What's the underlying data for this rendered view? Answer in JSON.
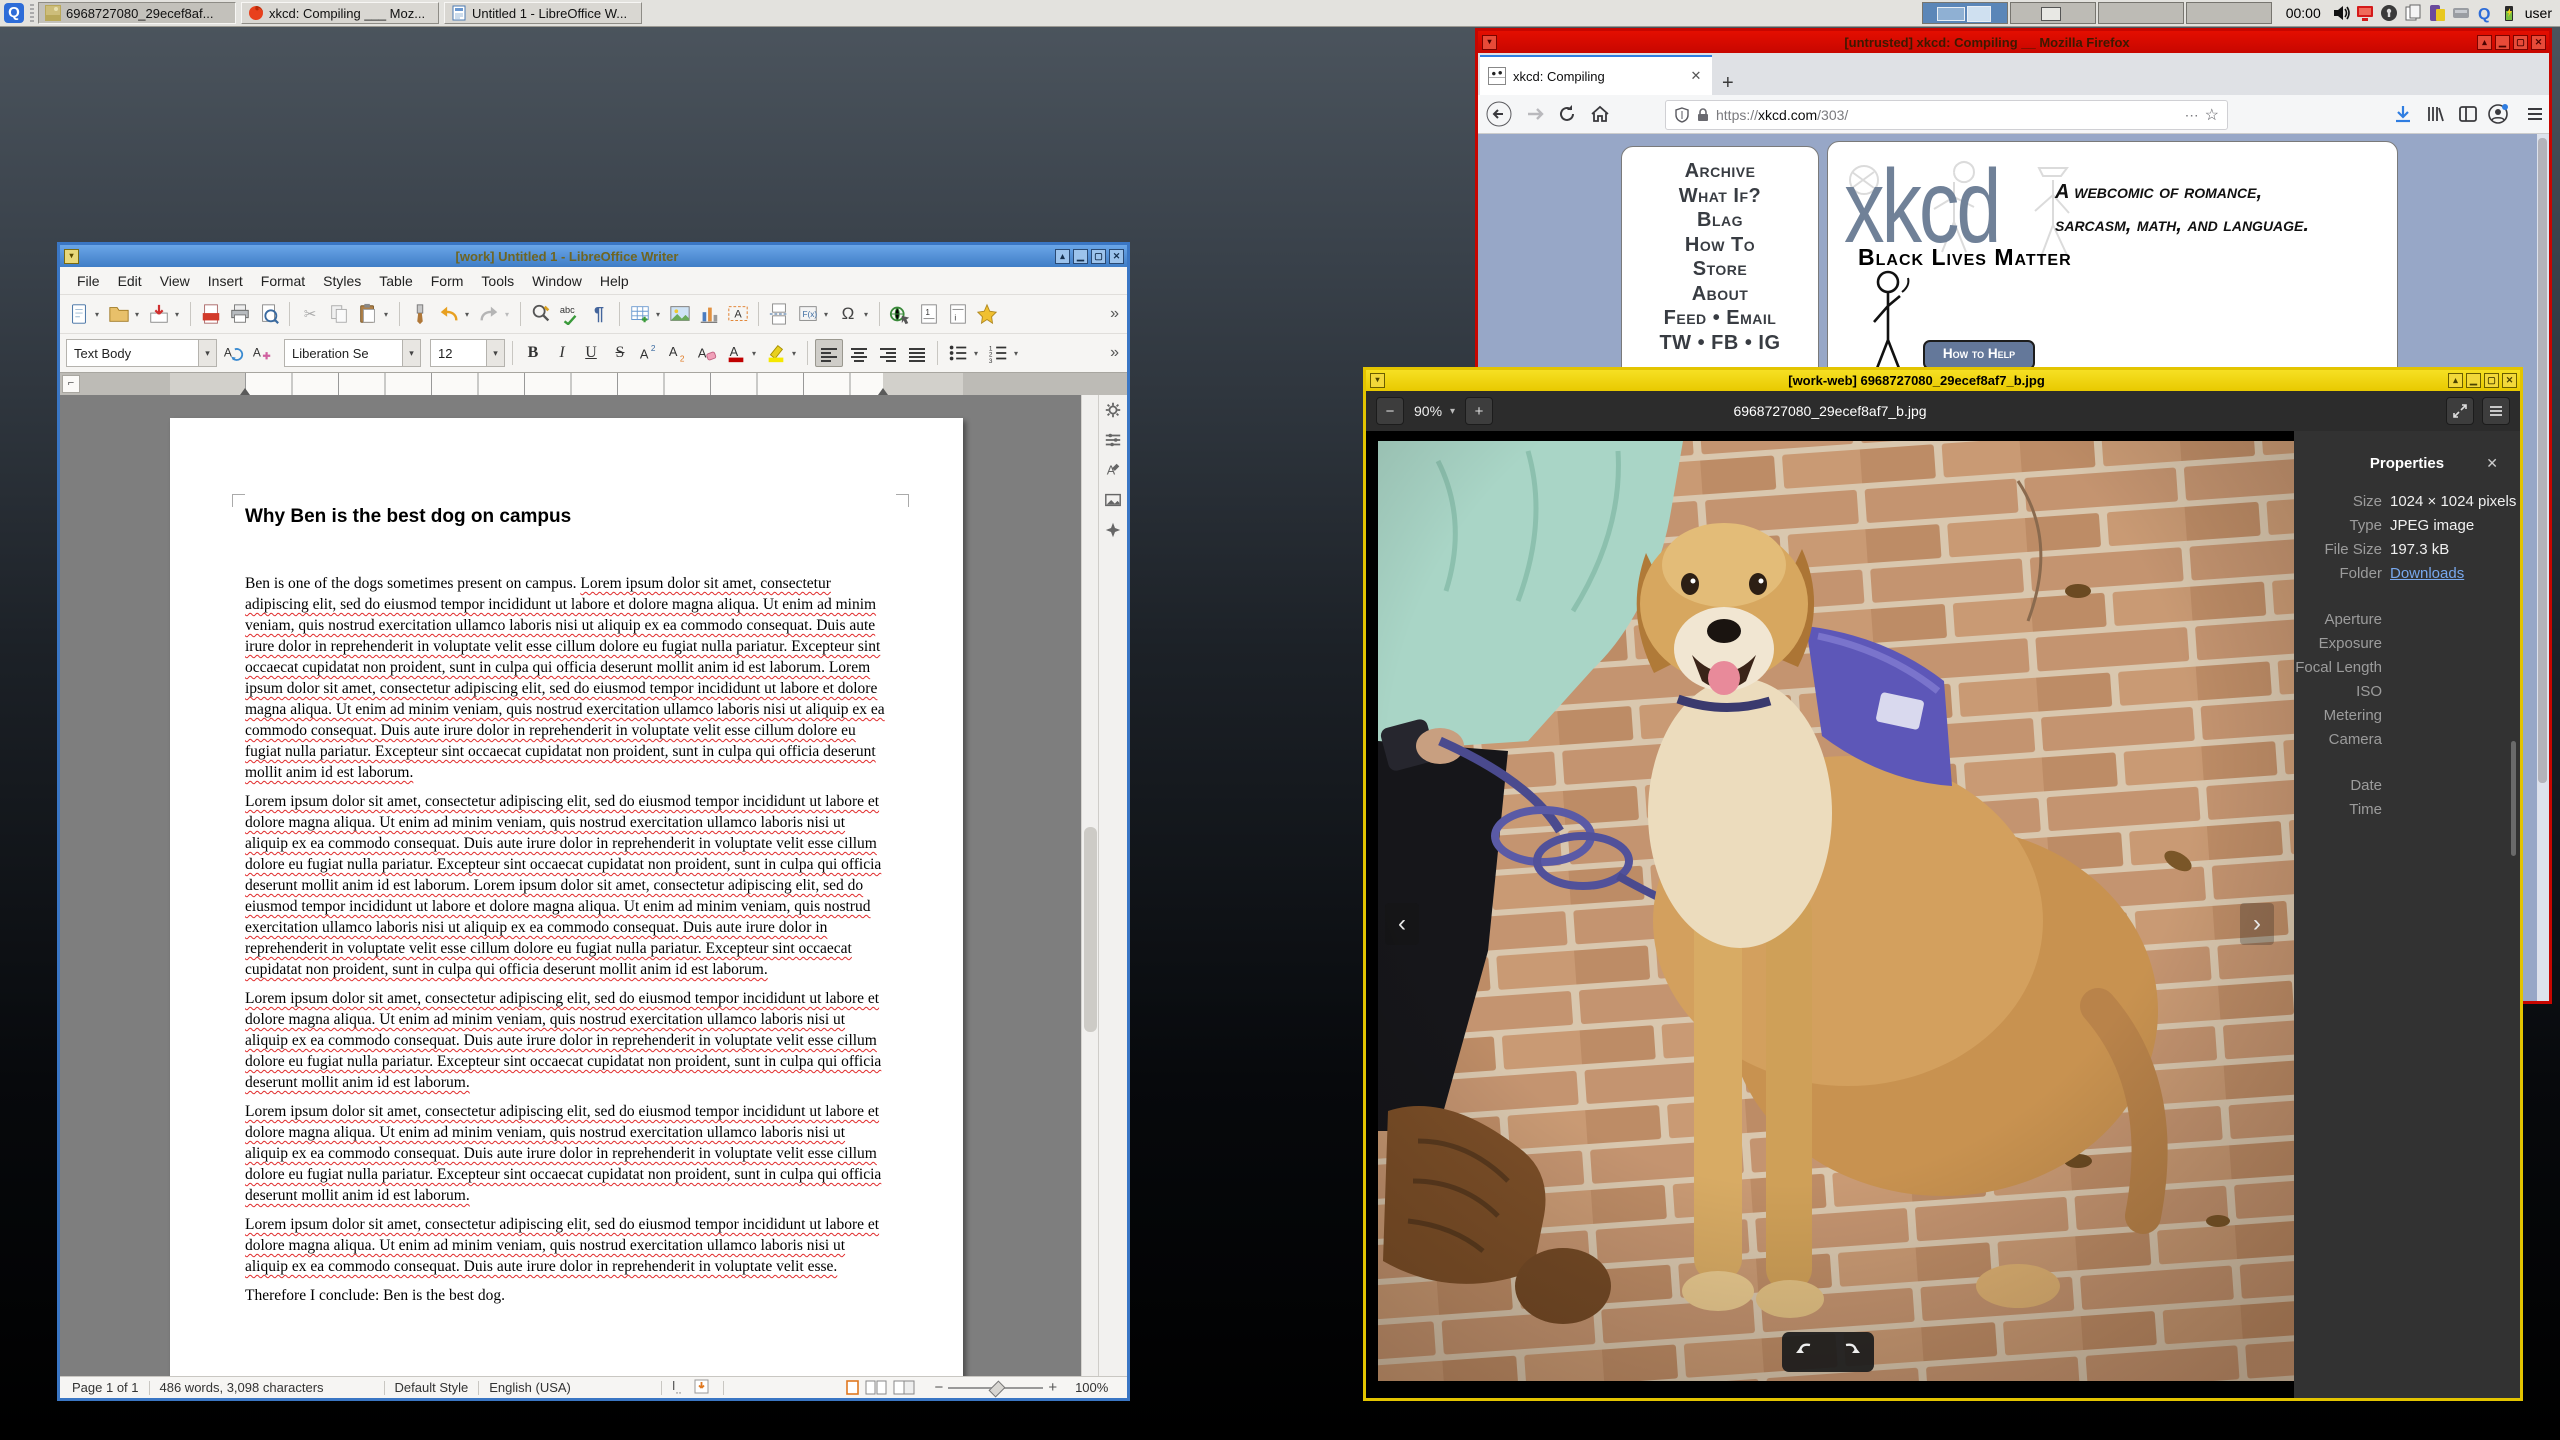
{
  "palette": {
    "qube_untrusted": "#c70600",
    "qube_work": "#3a76c4",
    "qube_work_web": "#e3c400",
    "xkcd_bg": "#97a7c7"
  },
  "taskbar": {
    "clock": "00:00",
    "user": "user",
    "buttons": [
      {
        "label": "6968727080_29ecef8af...",
        "icon": "image-thumbnail-icon"
      },
      {
        "label": "xkcd: Compiling ___ Moz...",
        "icon": "firefox-icon"
      },
      {
        "label": "Untitled 1 - LibreOffice W...",
        "icon": "writer-document-icon"
      }
    ],
    "tray_icons": [
      "volume-icon",
      "domains-icon",
      "lock-icon",
      "clipboard-icon",
      "devices-icon",
      "disk-icon",
      "qubes-icon",
      "battery-icon"
    ]
  },
  "firefox": {
    "title": "[untrusted] xkcd: Compiling __ Mozilla Firefox",
    "tab_label": "xkcd: Compiling",
    "tab_close": "✕",
    "new_tab": "+",
    "url_scheme": "https://",
    "url_host": "xkcd.com",
    "url_path": "/303/",
    "page_actions": "⋯",
    "bookmark_star": "☆",
    "xkcd": {
      "menu": [
        "Archive",
        "What If?",
        "Blag",
        "How To",
        "Store",
        "About",
        "Feed • Email",
        "TW • FB • IG"
      ],
      "logo": "xkcd",
      "tagline_line1": "A webcomic of romance,",
      "tagline_line2": "sarcasm, math, and language.",
      "blm": "Black Lives Matter",
      "help_button": "How to Help"
    }
  },
  "writer": {
    "title": "[work] Untitled 1 - LibreOffice Writer",
    "menu": [
      "File",
      "Edit",
      "View",
      "Insert",
      "Format",
      "Styles",
      "Table",
      "Form",
      "Tools",
      "Window",
      "Help"
    ],
    "menu_close": "✕",
    "style_combo": "Text Body",
    "font_combo": "Liberation Se",
    "size_combo": "12",
    "standard_toolbar_icons": [
      "new-document",
      "open",
      "save",
      "export-pdf",
      "print",
      "print-preview",
      "cut",
      "copy",
      "paste",
      "clone-formatting",
      "undo",
      "redo",
      "find-replace",
      "spelling",
      "formatting-marks",
      "insert-table",
      "insert-image",
      "insert-chart",
      "insert-textbox",
      "page-break",
      "insert-field",
      "special-character",
      "insert-hyperlink",
      "insert-footnote",
      "insert-endnote",
      "insert-bookmark"
    ],
    "doc": {
      "heading": "Why Ben is the best dog on campus",
      "p1_intro": "Ben is one of the dogs sometimes present on campus. ",
      "p1_lorem": "Lorem ipsum dolor sit amet, consectetur adipiscing elit, sed do eiusmod tempor incididunt ut labore et dolore magna aliqua. Ut enim ad minim veniam, quis nostrud exercitation ullamco laboris nisi ut aliquip ex ea commodo consequat. Duis aute irure dolor in reprehenderit in voluptate velit esse cillum dolore eu fugiat nulla pariatur. Excepteur sint occaecat cupidatat non proident, sunt in culpa qui officia deserunt mollit anim id est laborum. Lorem ipsum dolor sit amet, consectetur adipiscing elit, sed do eiusmod tempor incididunt ut labore et dolore magna aliqua. Ut enim ad minim veniam, quis nostrud exercitation ullamco laboris nisi ut aliquip ex ea commodo consequat. Duis aute irure dolor in reprehenderit in voluptate velit esse cillum dolore eu fugiat nulla pariatur. Excepteur sint occaecat cupidatat non proident, sunt in culpa qui officia deserunt mollit anim id est laborum.",
      "p2": "Lorem ipsum dolor sit amet, consectetur adipiscing elit, sed do eiusmod tempor incididunt ut labore et dolore magna aliqua. Ut enim ad minim veniam, quis nostrud exercitation ullamco laboris nisi ut aliquip ex ea commodo consequat. Duis aute irure dolor in reprehenderit in voluptate velit esse cillum dolore eu fugiat nulla pariatur. Excepteur sint occaecat cupidatat non proident, sunt in culpa qui officia deserunt mollit anim id est laborum. Lorem ipsum dolor sit amet, consectetur adipiscing elit, sed do eiusmod tempor incididunt ut labore et dolore magna aliqua. Ut enim ad minim veniam, quis nostrud exercitation ullamco laboris nisi ut aliquip ex ea commodo consequat. Duis aute irure dolor in reprehenderit in voluptate velit esse cillum dolore eu fugiat nulla pariatur. Excepteur sint occaecat cupidatat non proident, sunt in culpa qui officia deserunt mollit anim id est laborum.",
      "p3": "Lorem ipsum dolor sit amet, consectetur adipiscing elit, sed do eiusmod tempor incididunt ut labore et dolore magna aliqua. Ut enim ad minim veniam, quis nostrud exercitation ullamco laboris nisi ut aliquip ex ea commodo consequat. Duis aute irure dolor in reprehenderit in voluptate velit esse cillum dolore eu fugiat nulla pariatur. Excepteur sint occaecat cupidatat non proident, sunt in culpa qui officia deserunt mollit anim id est laborum.",
      "p4": "Lorem ipsum dolor sit amet, consectetur adipiscing elit, sed do eiusmod tempor incididunt ut labore et dolore magna aliqua. Ut enim ad minim veniam, quis nostrud exercitation ullamco laboris nisi ut aliquip ex ea commodo consequat. Duis aute irure dolor in reprehenderit in voluptate velit esse cillum dolore eu fugiat nulla pariatur. Excepteur sint occaecat cupidatat non proident, sunt in culpa qui officia deserunt mollit anim id est laborum.",
      "p5": "Lorem ipsum dolor sit amet, consectetur adipiscing elit, sed do eiusmod tempor incididunt ut labore et dolore magna aliqua. Ut enim ad minim veniam, quis nostrud exercitation ullamco laboris nisi ut aliquip ex ea commodo consequat. Duis aute irure dolor in reprehenderit in voluptate velit esse.",
      "conclusion": "Therefore I conclude: Ben is the best dog."
    },
    "status": {
      "page": "Page 1 of 1",
      "words": "486 words, 3,098 characters",
      "style": "Default Style",
      "lang": "English (USA)",
      "zoom": "100%"
    }
  },
  "viewer": {
    "title": "[work-web] 6968727080_29ecef8af7_b.jpg",
    "zoom": "90%",
    "filename": "6968727080_29ecef8af7_b.jpg",
    "props": {
      "title": "Properties",
      "close": "✕",
      "size_label": "Size",
      "size_value": "1024 × 1024 pixels",
      "type_label": "Type",
      "type_value": "JPEG image",
      "filesize_label": "File Size",
      "filesize_value": "197.3 kB",
      "folder_label": "Folder",
      "folder_value": "Downloads",
      "exif_labels": [
        "Aperture",
        "Exposure",
        "Focal Length",
        "ISO",
        "Metering",
        "Camera"
      ],
      "datetime_labels": [
        "Date",
        "Time"
      ]
    }
  }
}
